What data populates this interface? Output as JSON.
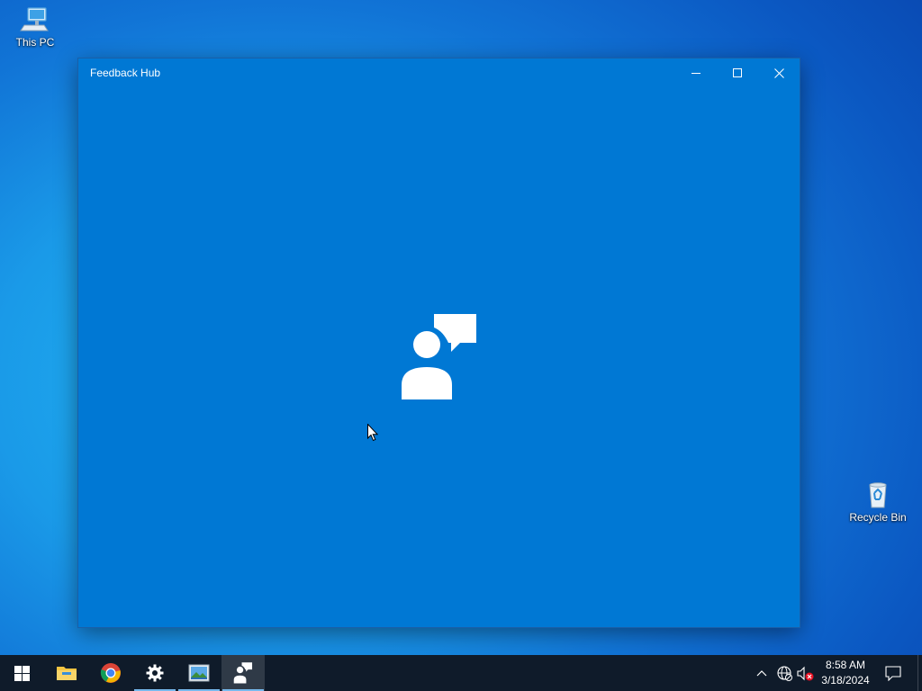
{
  "desktop": {
    "icons": [
      {
        "label": "This PC",
        "icon": "computer-icon"
      },
      {
        "label": "Recycle Bin",
        "icon": "recycle-bin-icon"
      }
    ]
  },
  "window": {
    "title": "Feedback Hub",
    "background": "#0078d4",
    "controls": {
      "minimize_icon": "minimize-icon",
      "maximize_icon": "maximize-icon",
      "close_icon": "close-icon"
    },
    "splash_icon": "feedback-hub-logo-icon"
  },
  "taskbar": {
    "apps": [
      {
        "name": "Start",
        "icon": "windows-logo-icon",
        "running": false
      },
      {
        "name": "File Explorer",
        "icon": "folder-icon",
        "running": false
      },
      {
        "name": "Google Chrome",
        "icon": "chrome-icon",
        "running": false
      },
      {
        "name": "Settings",
        "icon": "gear-icon",
        "running": true
      },
      {
        "name": "Image app",
        "icon": "picture-icon",
        "running": true
      },
      {
        "name": "Feedback Hub",
        "icon": "feedback-hub-icon",
        "running": true,
        "focused": true
      }
    ],
    "tray": {
      "chevron_icon": "chevron-up-icon",
      "network_icon": "globe-icon",
      "volume_icon": "volume-muted-icon",
      "time": "8:58 AM",
      "date": "3/18/2024",
      "notification_icon": "action-center-icon"
    },
    "accent": "#76b9ed"
  }
}
